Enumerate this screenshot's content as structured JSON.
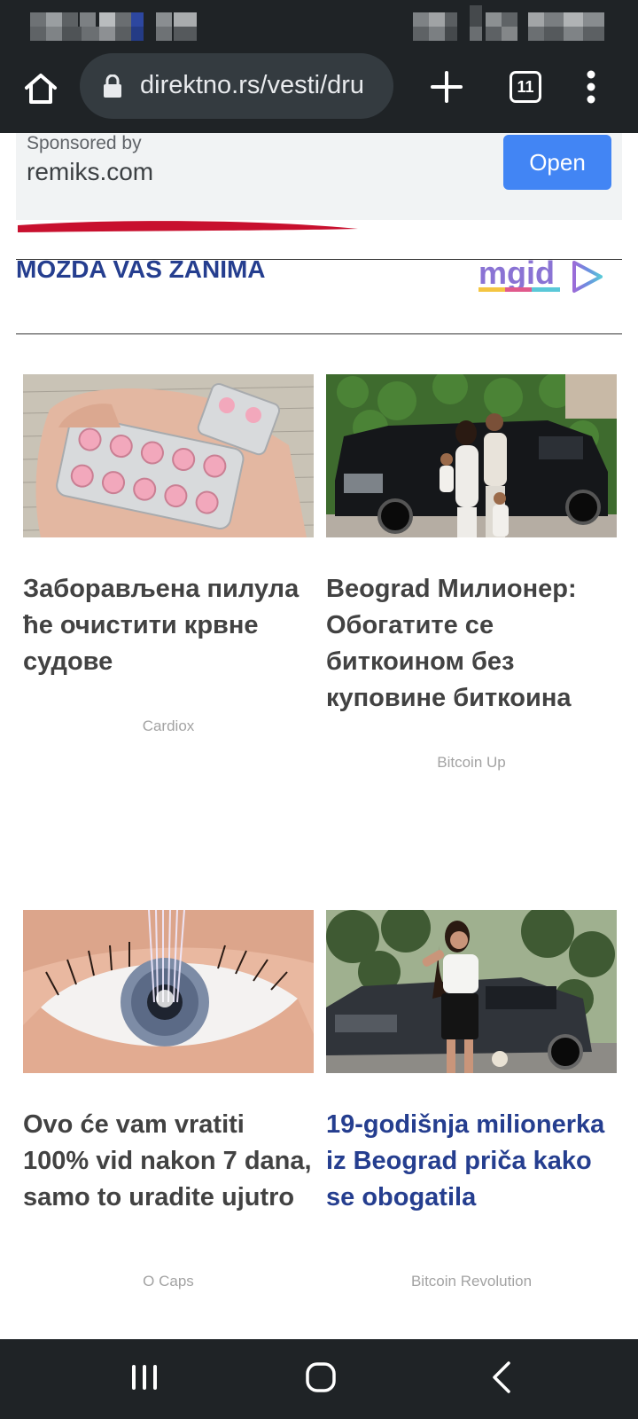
{
  "browser": {
    "url": "direktno.rs/vesti/dru",
    "tab_count": "11"
  },
  "ad": {
    "sponsored_label": "Sponsored by",
    "domain": "remiks.com",
    "open_label": "Open"
  },
  "section": {
    "title": "MOZDA VAS ZANIMA",
    "provider_logo": "mgid"
  },
  "cards": [
    {
      "title": "Заборављена пилула ће очистити крвне судове",
      "source": "Cardiox",
      "image": "pink-pill-blister-in-hand",
      "title_color": "#424242"
    },
    {
      "title": "Beograd Милионер: Обогатите се биткоином без куповине биткоина",
      "source": "Bitcoin Up",
      "image": "family-next-to-black-suv",
      "title_color": "#424242"
    },
    {
      "title": "Ovo će vam vratiti 100% vid nakon 7 dana, samo to uradite ujutro",
      "source": "O Caps",
      "image": "eye-closeup-with-laser",
      "title_color": "#424242"
    },
    {
      "title": "19-godišnja milionerka iz Beograd priča kako se obogatila",
      "source": "Bitcoin Revolution",
      "image": "woman-next-to-dark-car",
      "title_color": "#253e8f"
    }
  ],
  "icons": {
    "home": "home-icon",
    "lock": "lock-icon",
    "new_tab": "plus-icon",
    "menu": "more-vert-icon",
    "nav_recents": "recents-icon",
    "nav_home": "home-circle-icon",
    "nav_back": "back-chevron-icon"
  },
  "colors": {
    "chrome_dark": "#1f2326",
    "url_pill": "#343b40",
    "accent_blue": "#4285f4",
    "headline_navy": "#253e8f",
    "ad_banner_bg": "#f1f3f4"
  }
}
